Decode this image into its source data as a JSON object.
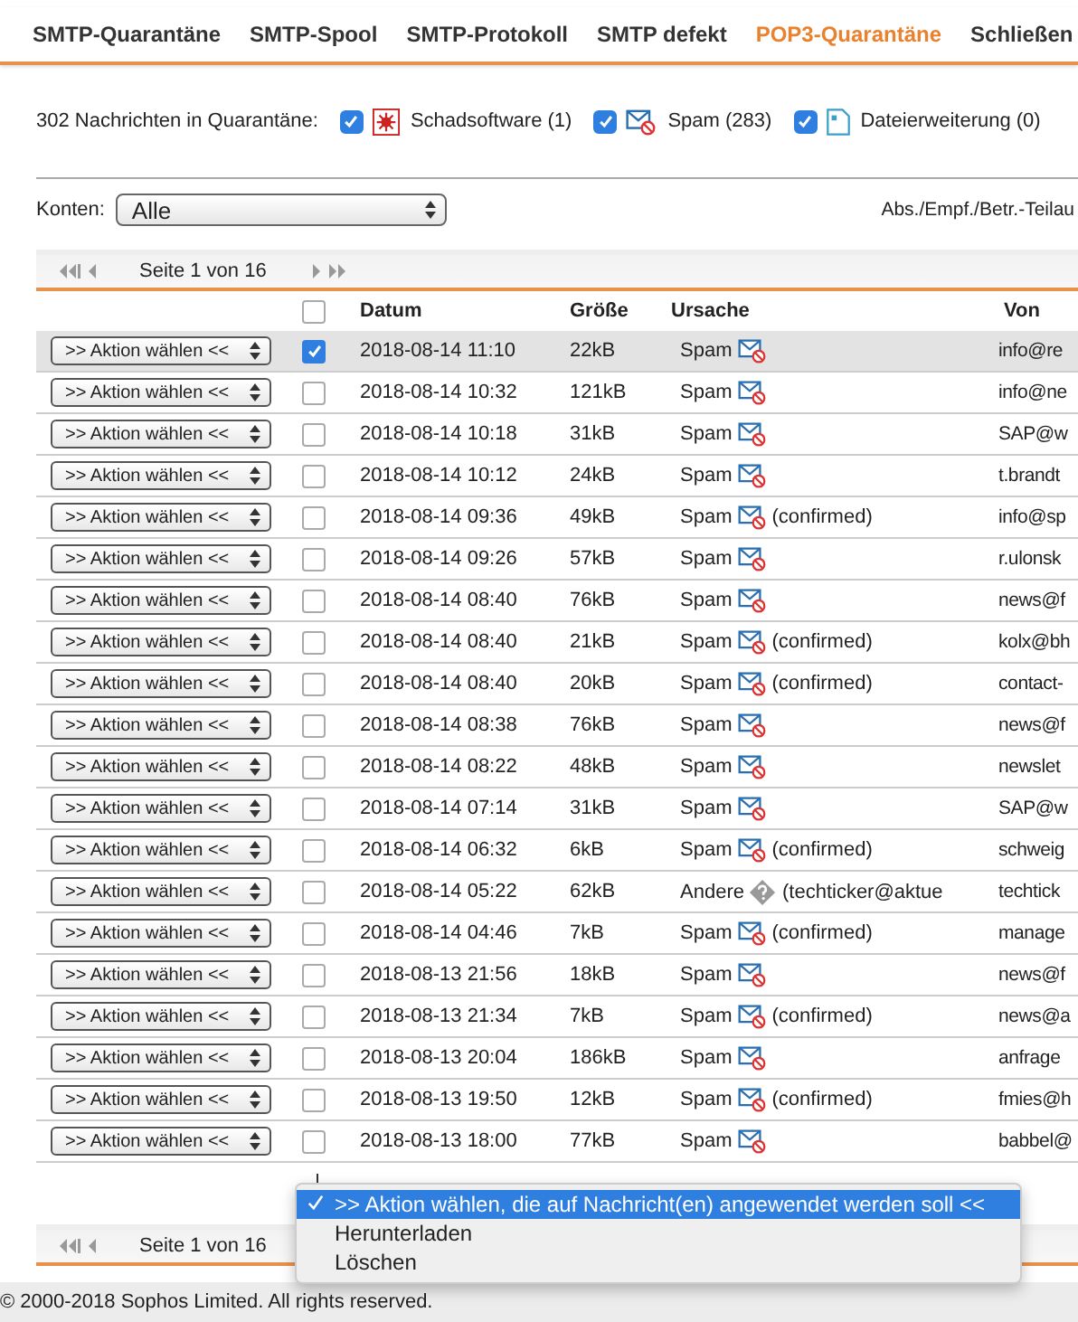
{
  "tabs": [
    {
      "label": "SMTP-Quarantäne",
      "selected": false
    },
    {
      "label": "SMTP-Spool",
      "selected": false
    },
    {
      "label": "SMTP-Protokoll",
      "selected": false
    },
    {
      "label": "SMTP defekt",
      "selected": false
    },
    {
      "label": "POP3-Quarantäne",
      "selected": true
    },
    {
      "label": "Schließen",
      "selected": false
    }
  ],
  "summary": "302 Nachrichten in Quarantäne:",
  "filters": [
    {
      "kind": "malware",
      "label": "Schadsoftware (1)",
      "checked": true
    },
    {
      "kind": "spam",
      "label": "Spam (283)",
      "checked": true
    },
    {
      "kind": "file",
      "label": "Dateierweiterung (0)",
      "checked": true
    }
  ],
  "accounts": {
    "label": "Konten:",
    "value": "Alle"
  },
  "search_label": "Abs./Empf./Betr.-Teilau",
  "pager_top": "Seite 1 von 16",
  "pager_bottom": "Seite 1 von 16",
  "columns": [
    "Datum",
    "Größe",
    "Ursache",
    "Von"
  ],
  "select_all": false,
  "rows": [
    {
      "action": ">> Aktion wählen <<",
      "selected": true,
      "checked": true,
      "date": "2018-08-14 11:10",
      "size": "22kB",
      "cause": "Spam",
      "kind": "spam",
      "from": "info@re"
    },
    {
      "action": ">> Aktion wählen <<",
      "selected": false,
      "checked": false,
      "date": "2018-08-14 10:32",
      "size": "121kB",
      "cause": "Spam",
      "kind": "spam",
      "from": "info@ne"
    },
    {
      "action": ">> Aktion wählen <<",
      "selected": false,
      "checked": false,
      "date": "2018-08-14 10:18",
      "size": "31kB",
      "cause": "Spam",
      "kind": "spam",
      "from": "SAP@w"
    },
    {
      "action": ">> Aktion wählen <<",
      "selected": false,
      "checked": false,
      "date": "2018-08-14 10:12",
      "size": "24kB",
      "cause": "Spam",
      "kind": "spam",
      "from": "t.brandt"
    },
    {
      "action": ">> Aktion wählen <<",
      "selected": false,
      "checked": false,
      "date": "2018-08-14 09:36",
      "size": "49kB",
      "cause": "Spam",
      "kind": "spam",
      "note": "(confirmed)",
      "from": "info@sp"
    },
    {
      "action": ">> Aktion wählen <<",
      "selected": false,
      "checked": false,
      "date": "2018-08-14 09:26",
      "size": "57kB",
      "cause": "Spam",
      "kind": "spam",
      "from": "r.ulonsk"
    },
    {
      "action": ">> Aktion wählen <<",
      "selected": false,
      "checked": false,
      "date": "2018-08-14 08:40",
      "size": "76kB",
      "cause": "Spam",
      "kind": "spam",
      "from": "news@f"
    },
    {
      "action": ">> Aktion wählen <<",
      "selected": false,
      "checked": false,
      "date": "2018-08-14 08:40",
      "size": "21kB",
      "cause": "Spam",
      "kind": "spam",
      "note": "(confirmed)",
      "from": "kolx@bh"
    },
    {
      "action": ">> Aktion wählen <<",
      "selected": false,
      "checked": false,
      "date": "2018-08-14 08:40",
      "size": "20kB",
      "cause": "Spam",
      "kind": "spam",
      "note": "(confirmed)",
      "from": "contact-"
    },
    {
      "action": ">> Aktion wählen <<",
      "selected": false,
      "checked": false,
      "date": "2018-08-14 08:38",
      "size": "76kB",
      "cause": "Spam",
      "kind": "spam",
      "from": "news@f"
    },
    {
      "action": ">> Aktion wählen <<",
      "selected": false,
      "checked": false,
      "date": "2018-08-14 08:22",
      "size": "48kB",
      "cause": "Spam",
      "kind": "spam",
      "from": "newslet"
    },
    {
      "action": ">> Aktion wählen <<",
      "selected": false,
      "checked": false,
      "date": "2018-08-14 07:14",
      "size": "31kB",
      "cause": "Spam",
      "kind": "spam",
      "from": "SAP@w"
    },
    {
      "action": ">> Aktion wählen <<",
      "selected": false,
      "checked": false,
      "date": "2018-08-14 06:32",
      "size": "6kB",
      "cause": "Spam",
      "kind": "spam",
      "note": "(confirmed)",
      "from": "schweig"
    },
    {
      "action": ">> Aktion wählen <<",
      "selected": false,
      "checked": false,
      "date": "2018-08-14 05:22",
      "size": "62kB",
      "cause": "Andere",
      "kind": "other",
      "note": "(techticker@aktue",
      "from": "techtick"
    },
    {
      "action": ">> Aktion wählen <<",
      "selected": false,
      "checked": false,
      "date": "2018-08-14 04:46",
      "size": "7kB",
      "cause": "Spam",
      "kind": "spam",
      "note": "(confirmed)",
      "from": "manage"
    },
    {
      "action": ">> Aktion wählen <<",
      "selected": false,
      "checked": false,
      "date": "2018-08-13 21:56",
      "size": "18kB",
      "cause": "Spam",
      "kind": "spam",
      "from": "news@f"
    },
    {
      "action": ">> Aktion wählen <<",
      "selected": false,
      "checked": false,
      "date": "2018-08-13 21:34",
      "size": "7kB",
      "cause": "Spam",
      "kind": "spam",
      "note": "(confirmed)",
      "from": "news@a"
    },
    {
      "action": ">> Aktion wählen <<",
      "selected": false,
      "checked": false,
      "date": "2018-08-13 20:04",
      "size": "186kB",
      "cause": "Spam",
      "kind": "spam",
      "from": "anfrage"
    },
    {
      "action": ">> Aktion wählen <<",
      "selected": false,
      "checked": false,
      "date": "2018-08-13 19:50",
      "size": "12kB",
      "cause": "Spam",
      "kind": "spam",
      "note": "(confirmed)",
      "from": "fmies@h"
    },
    {
      "action": ">> Aktion wählen <<",
      "selected": false,
      "checked": false,
      "date": "2018-08-13 18:00",
      "size": "77kB",
      "cause": "Spam",
      "kind": "spam",
      "from": "babbel@"
    }
  ],
  "bulk_menu": [
    {
      "label": ">> Aktion wählen, die auf Nachricht(en) angewendet werden soll <<",
      "selected": true
    },
    {
      "label": "Herunterladen",
      "selected": false
    },
    {
      "label": "Löschen",
      "selected": false
    }
  ],
  "footer": "© 2000-2018 Sophos Limited. All rights reserved."
}
